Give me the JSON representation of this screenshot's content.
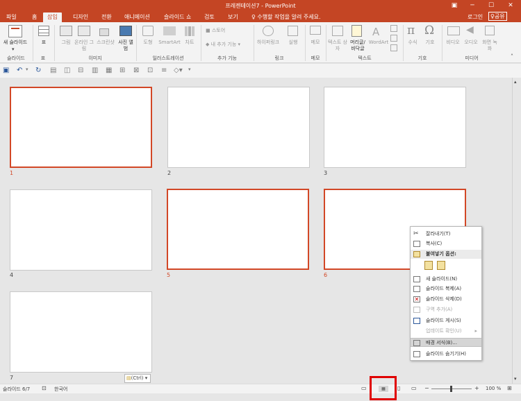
{
  "titlebar": {
    "title": "프레젠테이션7 - PowerPoint",
    "buttons": [
      "▣",
      "─",
      "☐",
      "✕"
    ]
  },
  "tabs": [
    {
      "label": "파일",
      "active": false
    },
    {
      "label": "홈",
      "active": false
    },
    {
      "label": "삽입",
      "active": true
    },
    {
      "label": "디자인",
      "active": false
    },
    {
      "label": "전환",
      "active": false
    },
    {
      "label": "애니메이션",
      "active": false
    },
    {
      "label": "슬라이드 쇼",
      "active": false
    },
    {
      "label": "검토",
      "active": false
    },
    {
      "label": "보기",
      "active": false
    }
  ],
  "tellme": "♀ 수행할 작업을 알려 주세요.",
  "login": "로그인",
  "share": "공유",
  "ribbon": {
    "new_slide": "새 슬라이드",
    "table": "표",
    "image": "그림",
    "online_image": "온라인 그림",
    "screenshot": "스크린샷",
    "photo_album": "사진 앨범",
    "shapes": "도형",
    "smartart": "SmartArt",
    "chart": "차트",
    "store": "스토어",
    "my_addins": "내 추가 기능",
    "hyperlink": "하이퍼링크",
    "action": "실행",
    "comment": "메모",
    "textbox": "텍스트 상자",
    "header_footer": "머리글/ 바닥글",
    "wordart": "WordArt",
    "equation": "수식",
    "symbol": "기호",
    "video": "비디오",
    "audio": "오디오",
    "screen_record": "화면 녹화",
    "groups": [
      "슬라이드",
      "표",
      "이미지",
      "일러스트레이션",
      "추가 기능",
      "링크",
      "메모",
      "텍스트",
      "기호",
      "미디어"
    ]
  },
  "slides": [
    {
      "number": "1",
      "selected": true
    },
    {
      "number": "2",
      "selected": false
    },
    {
      "number": "3",
      "selected": false
    },
    {
      "number": "4",
      "selected": false
    },
    {
      "number": "5",
      "selected": true
    },
    {
      "number": "6",
      "selected": true
    },
    {
      "number": "7",
      "selected": false
    }
  ],
  "ctrl_tag": "(Ctrl) ▾",
  "context_menu": {
    "items": [
      {
        "label": "잘라내기(T)",
        "disabled": false,
        "icon": "scissors-icon"
      },
      {
        "label": "복사(C)",
        "disabled": false,
        "icon": "copy-icon"
      },
      {
        "label": "붙여넣기 옵션:",
        "disabled": false,
        "icon": "paste-icon",
        "header": true
      },
      {
        "label": "새 슬라이드(N)",
        "disabled": false,
        "icon": "new-slide-icon"
      },
      {
        "label": "슬라이드 복제(A)",
        "disabled": false,
        "icon": "duplicate-slide-icon"
      },
      {
        "label": "슬라이드 삭제(D)",
        "disabled": false,
        "icon": "delete-slide-icon"
      },
      {
        "label": "구역 추가(A)",
        "disabled": true,
        "icon": "add-section-icon"
      },
      {
        "label": "슬라이드 게시(S)",
        "disabled": false,
        "icon": "publish-slide-icon"
      },
      {
        "label": "업데이트 확인(U)",
        "disabled": true,
        "icon": "update-icon",
        "submenu": true
      },
      {
        "label": "배경 서식(B)...",
        "disabled": false,
        "icon": "background-format-icon",
        "highlighted": true
      },
      {
        "label": "슬라이드 숨기기(H)",
        "disabled": false,
        "icon": "hide-slide-icon"
      }
    ]
  },
  "status": {
    "slide_info": "슬라이드 6/7",
    "language": "한국어",
    "zoom": "100 %"
  }
}
